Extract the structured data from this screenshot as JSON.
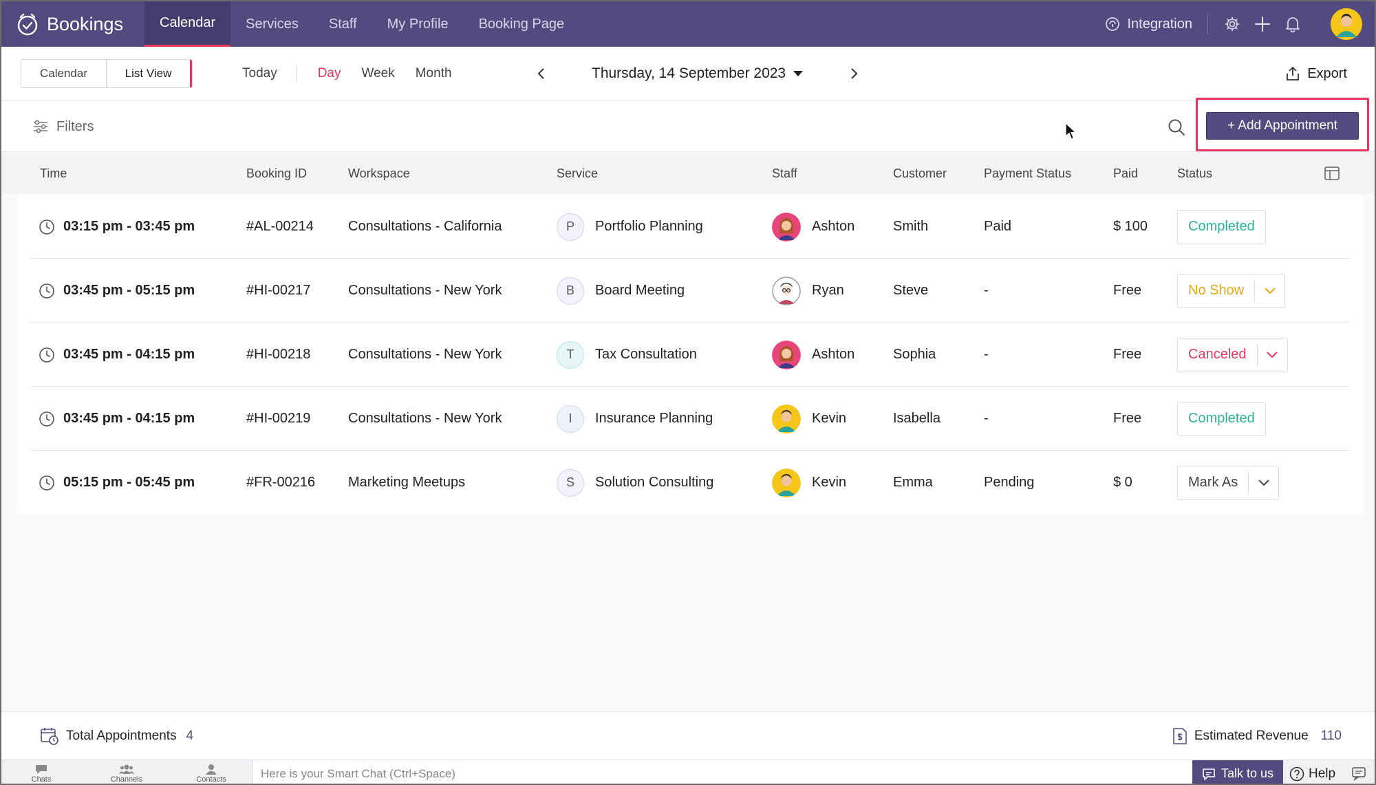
{
  "app": {
    "name": "Bookings"
  },
  "nav": {
    "tabs": [
      {
        "label": "Calendar",
        "active": true
      },
      {
        "label": "Services"
      },
      {
        "label": "Staff"
      },
      {
        "label": "My Profile"
      },
      {
        "label": "Booking Page"
      }
    ],
    "integration_label": "Integration"
  },
  "toolbar": {
    "view_calendar": "Calendar",
    "view_list": "List View",
    "range_today": "Today",
    "range_day": "Day",
    "range_week": "Week",
    "range_month": "Month",
    "date": "Thursday, 14 September 2023",
    "export_label": "Export"
  },
  "filterbar": {
    "filters_label": "Filters",
    "add_label": "+ Add Appointment"
  },
  "table": {
    "headers": [
      "Time",
      "Booking ID",
      "Workspace",
      "Service",
      "Staff",
      "Customer",
      "Payment Status",
      "Paid",
      "Status"
    ],
    "rows": [
      {
        "time": "03:15 pm - 03:45 pm",
        "id": "#AL-00214",
        "workspace": "Consultations - California",
        "svc_letter": "P",
        "service": "Portfolio Planning",
        "staff": "Ashton",
        "customer": "Smith",
        "payment": "Paid",
        "paid": "$ 100",
        "status": "Completed"
      },
      {
        "time": "03:45 pm - 05:15 pm",
        "id": "#HI-00217",
        "workspace": "Consultations - New York",
        "svc_letter": "B",
        "service": "Board Meeting",
        "staff": "Ryan",
        "customer": "Steve",
        "payment": "-",
        "paid": "Free",
        "status": "No Show"
      },
      {
        "time": "03:45 pm - 04:15 pm",
        "id": "#HI-00218",
        "workspace": "Consultations - New York",
        "svc_letter": "T",
        "service": "Tax Consultation",
        "staff": "Ashton",
        "customer": "Sophia",
        "payment": "-",
        "paid": "Free",
        "status": "Canceled"
      },
      {
        "time": "03:45 pm - 04:15 pm",
        "id": "#HI-00219",
        "workspace": "Consultations - New York",
        "svc_letter": "I",
        "service": "Insurance Planning",
        "staff": "Kevin",
        "customer": "Isabella",
        "payment": "-",
        "paid": "Free",
        "status": "Completed"
      },
      {
        "time": "05:15 pm - 05:45 pm",
        "id": "#FR-00216",
        "workspace": "Marketing Meetups",
        "svc_letter": "S",
        "service": "Solution Consulting",
        "staff": "Kevin",
        "customer": "Emma",
        "payment": "Pending",
        "paid": "$ 0",
        "status": "Mark As"
      }
    ]
  },
  "summary": {
    "total_label": "Total Appointments",
    "total_value": "4",
    "revenue_label": "Estimated Revenue",
    "revenue_value": "110"
  },
  "bottombar": {
    "chats": "Chats",
    "channels": "Channels",
    "contacts": "Contacts",
    "smartchat_placeholder": "Here is your Smart Chat (Ctrl+Space)",
    "talk_label": "Talk to us",
    "help_label": "Help"
  },
  "colors": {
    "nav_bg": "#524b80",
    "accent": "#e8365d",
    "completed": "#29b39a",
    "noshow": "#e6a817",
    "canceled": "#e8365d"
  }
}
